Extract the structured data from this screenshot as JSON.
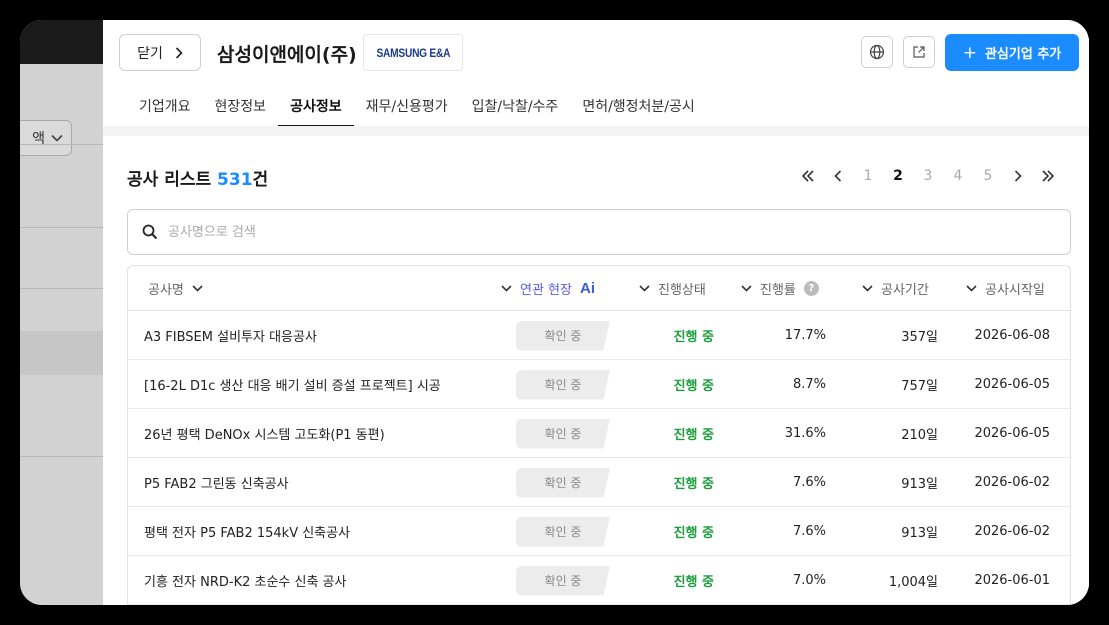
{
  "background": {
    "dropdown_label": "액"
  },
  "header": {
    "close_label": "닫기",
    "company_name": "삼성이앤에이(주)",
    "company_logo_text": "SAMSUNG E&A",
    "add_button_label": "관심기업 추가"
  },
  "tabs": [
    {
      "label": "기업개요",
      "active": false
    },
    {
      "label": "현장정보",
      "active": false
    },
    {
      "label": "공사정보",
      "active": true
    },
    {
      "label": "재무/신용평가",
      "active": false
    },
    {
      "label": "입찰/낙찰/수주",
      "active": false
    },
    {
      "label": "면허/행정처분/공시",
      "active": false
    }
  ],
  "section": {
    "title": "공사 리스트",
    "count": "531",
    "suffix": "건"
  },
  "pagination": {
    "pages": [
      "1",
      "2",
      "3",
      "4",
      "5"
    ],
    "current": "2"
  },
  "search": {
    "placeholder": "공사명으로 검색"
  },
  "table": {
    "headers": {
      "name": "공사명",
      "related_site": "연관 현장",
      "ai_badge": "Ai",
      "status": "진행상태",
      "progress": "진행률",
      "progress_help": "?",
      "period": "공사기간",
      "start": "공사시작일"
    },
    "rows": [
      {
        "name": "A3 FIBSEM 설비투자 대응공사",
        "related": "확인 중",
        "status": "진행 중",
        "progress": "17.7%",
        "period": "357일",
        "start": "2026-06-08"
      },
      {
        "name": "[16-2L D1c 생산 대응 배기 설비 증설 프로젝트] 시공",
        "related": "확인 중",
        "status": "진행 중",
        "progress": "8.7%",
        "period": "757일",
        "start": "2026-06-05"
      },
      {
        "name": "26년 평택 DeNOx 시스템 고도화(P1 동편)",
        "related": "확인 중",
        "status": "진행 중",
        "progress": "31.6%",
        "period": "210일",
        "start": "2026-06-05"
      },
      {
        "name": "P5 FAB2 그린동 신축공사",
        "related": "확인 중",
        "status": "진행 중",
        "progress": "7.6%",
        "period": "913일",
        "start": "2026-06-02"
      },
      {
        "name": "평택 전자 P5 FAB2 154kV 신축공사",
        "related": "확인 중",
        "status": "진행 중",
        "progress": "7.6%",
        "period": "913일",
        "start": "2026-06-02"
      },
      {
        "name": "기흥 전자 NRD-K2 초순수 신축 공사",
        "related": "확인 중",
        "status": "진행 중",
        "progress": "7.0%",
        "period": "1,004일",
        "start": "2026-06-01"
      }
    ]
  },
  "colors": {
    "accent": "#1a8cff",
    "status_green": "#1e9e3e",
    "ai_purple": "#5b5ce6"
  }
}
